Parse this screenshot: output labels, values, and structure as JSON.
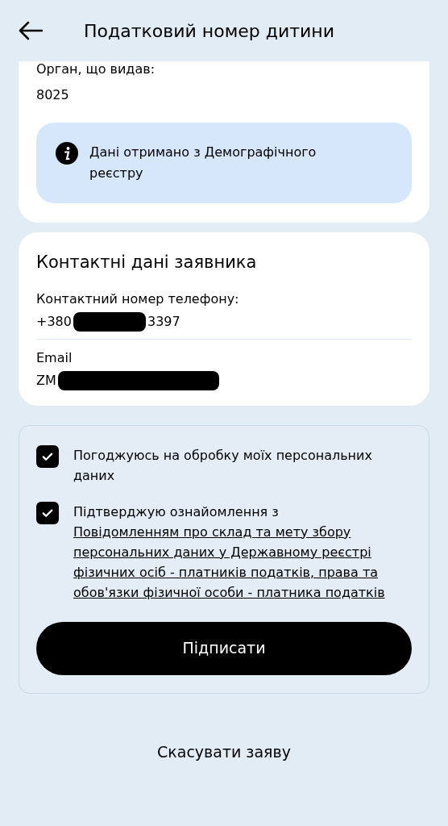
{
  "header": {
    "title": "Податковий номер дитини"
  },
  "issuer_card": {
    "label": "Орган, що видав:",
    "value": "8025",
    "notice": "Дані отримано з Демографічного реєстру"
  },
  "contact_card": {
    "title": "Контактні дані заявника",
    "fields": [
      {
        "label": "Контактний номер телефону:",
        "value_start": "+380",
        "value_end": "3397"
      },
      {
        "label": "Email",
        "value_start": "ZM"
      }
    ]
  },
  "consents": [
    {
      "checked": true,
      "text": "Погоджуюсь на обробку моїх персональних даних"
    },
    {
      "checked": true,
      "text": "Підтверджую ознайомлення з",
      "link": "Повідомленням про склад та мету збору персональних даних у Державному реєстрі фізичних осіб - платників податків, права та обов'язки фізичної особи - платника податків"
    }
  ],
  "sign_button": "Підписати",
  "cancel_button": "Скасувати заяву"
}
